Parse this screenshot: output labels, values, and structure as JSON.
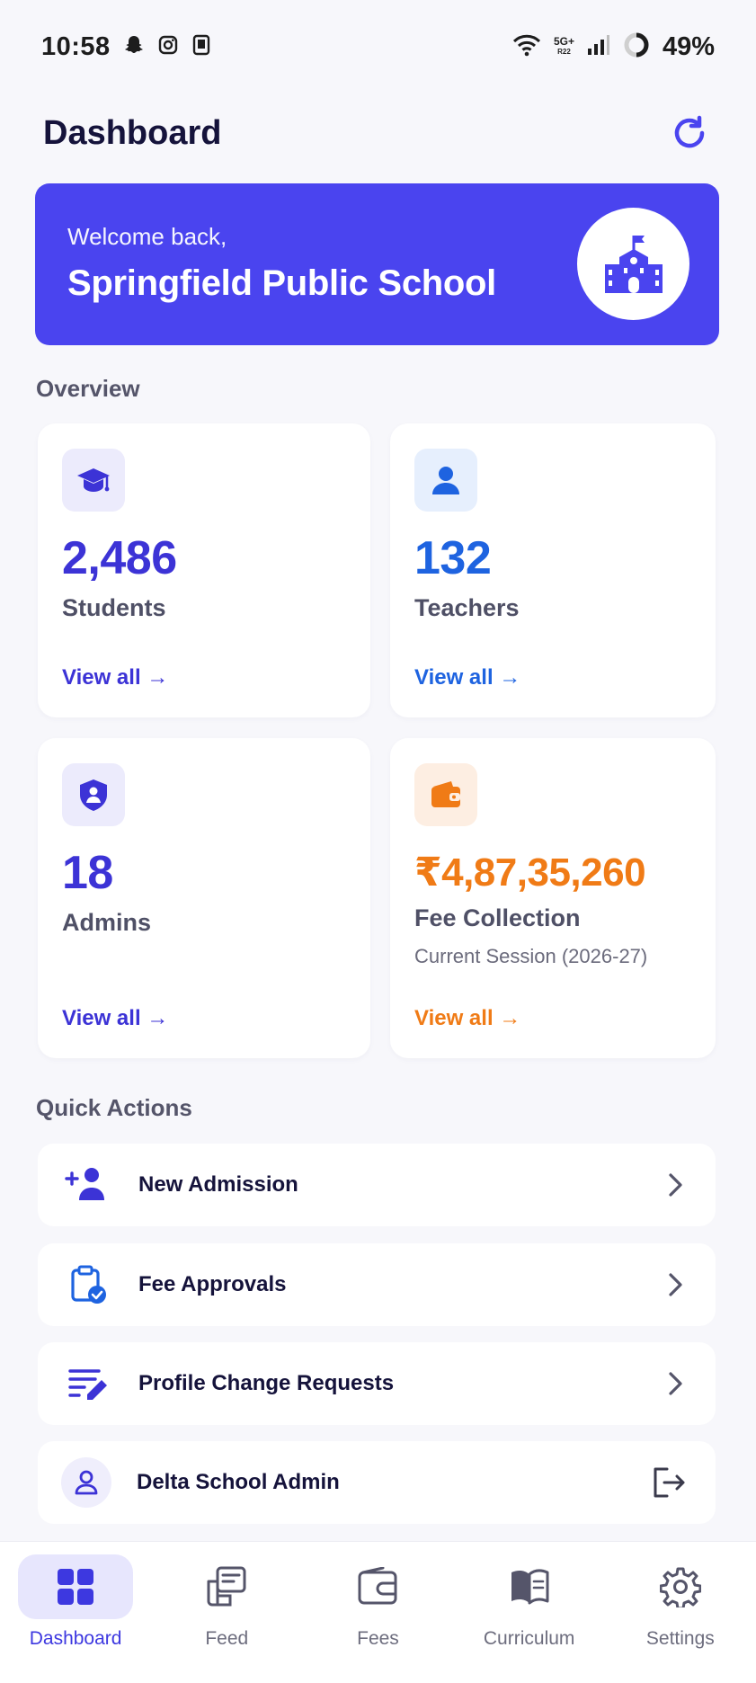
{
  "status_bar": {
    "time": "10:58",
    "battery": "49%",
    "network_top": "5G+",
    "network_bottom": "R22"
  },
  "header": {
    "title": "Dashboard",
    "refresh_icon": "refresh-icon"
  },
  "welcome": {
    "greeting": "Welcome back,",
    "school_name": "Springfield Public School",
    "icon": "school-building-icon"
  },
  "overview": {
    "label": "Overview",
    "cards": [
      {
        "value": "2,486",
        "label": "Students",
        "link": "View all →",
        "icon": "graduation-cap-icon",
        "color": "#3c33d6",
        "icon_bg": "#ecebfc"
      },
      {
        "value": "132",
        "label": "Teachers",
        "link": "View all →",
        "icon": "person-icon",
        "color": "#1e63e0",
        "icon_bg": "#e6effd"
      },
      {
        "value": "18",
        "label": "Admins",
        "link": "View all →",
        "icon": "admin-shield-icon",
        "color": "#3c33d6",
        "icon_bg": "#ecebfc"
      },
      {
        "value": "₹4,87,35,260",
        "label": "Fee Collection",
        "sub": "Current Session (2026-27)",
        "link": "View all →",
        "icon": "wallet-icon",
        "color": "#f07b16",
        "icon_bg": "#fdeee2"
      }
    ]
  },
  "quick_actions": {
    "label": "Quick Actions",
    "items": [
      {
        "label": "New Admission",
        "icon": "add-person-icon"
      },
      {
        "label": "Fee Approvals",
        "icon": "clipboard-check-icon"
      },
      {
        "label": "Profile Change Requests",
        "icon": "edit-list-icon"
      }
    ]
  },
  "account": {
    "label": "Delta School Admin",
    "icon": "user-icon",
    "action_icon": "logout-icon"
  },
  "nav": {
    "items": [
      {
        "label": "Dashboard",
        "icon": "grid-icon",
        "active": true
      },
      {
        "label": "Feed",
        "icon": "feed-icon"
      },
      {
        "label": "Fees",
        "icon": "wallet-icon"
      },
      {
        "label": "Curriculum",
        "icon": "book-icon"
      },
      {
        "label": "Settings",
        "icon": "gear-icon"
      }
    ]
  },
  "colors": {
    "primary": "#4a44ef",
    "orange": "#f07b16",
    "blue": "#1e63e0"
  }
}
